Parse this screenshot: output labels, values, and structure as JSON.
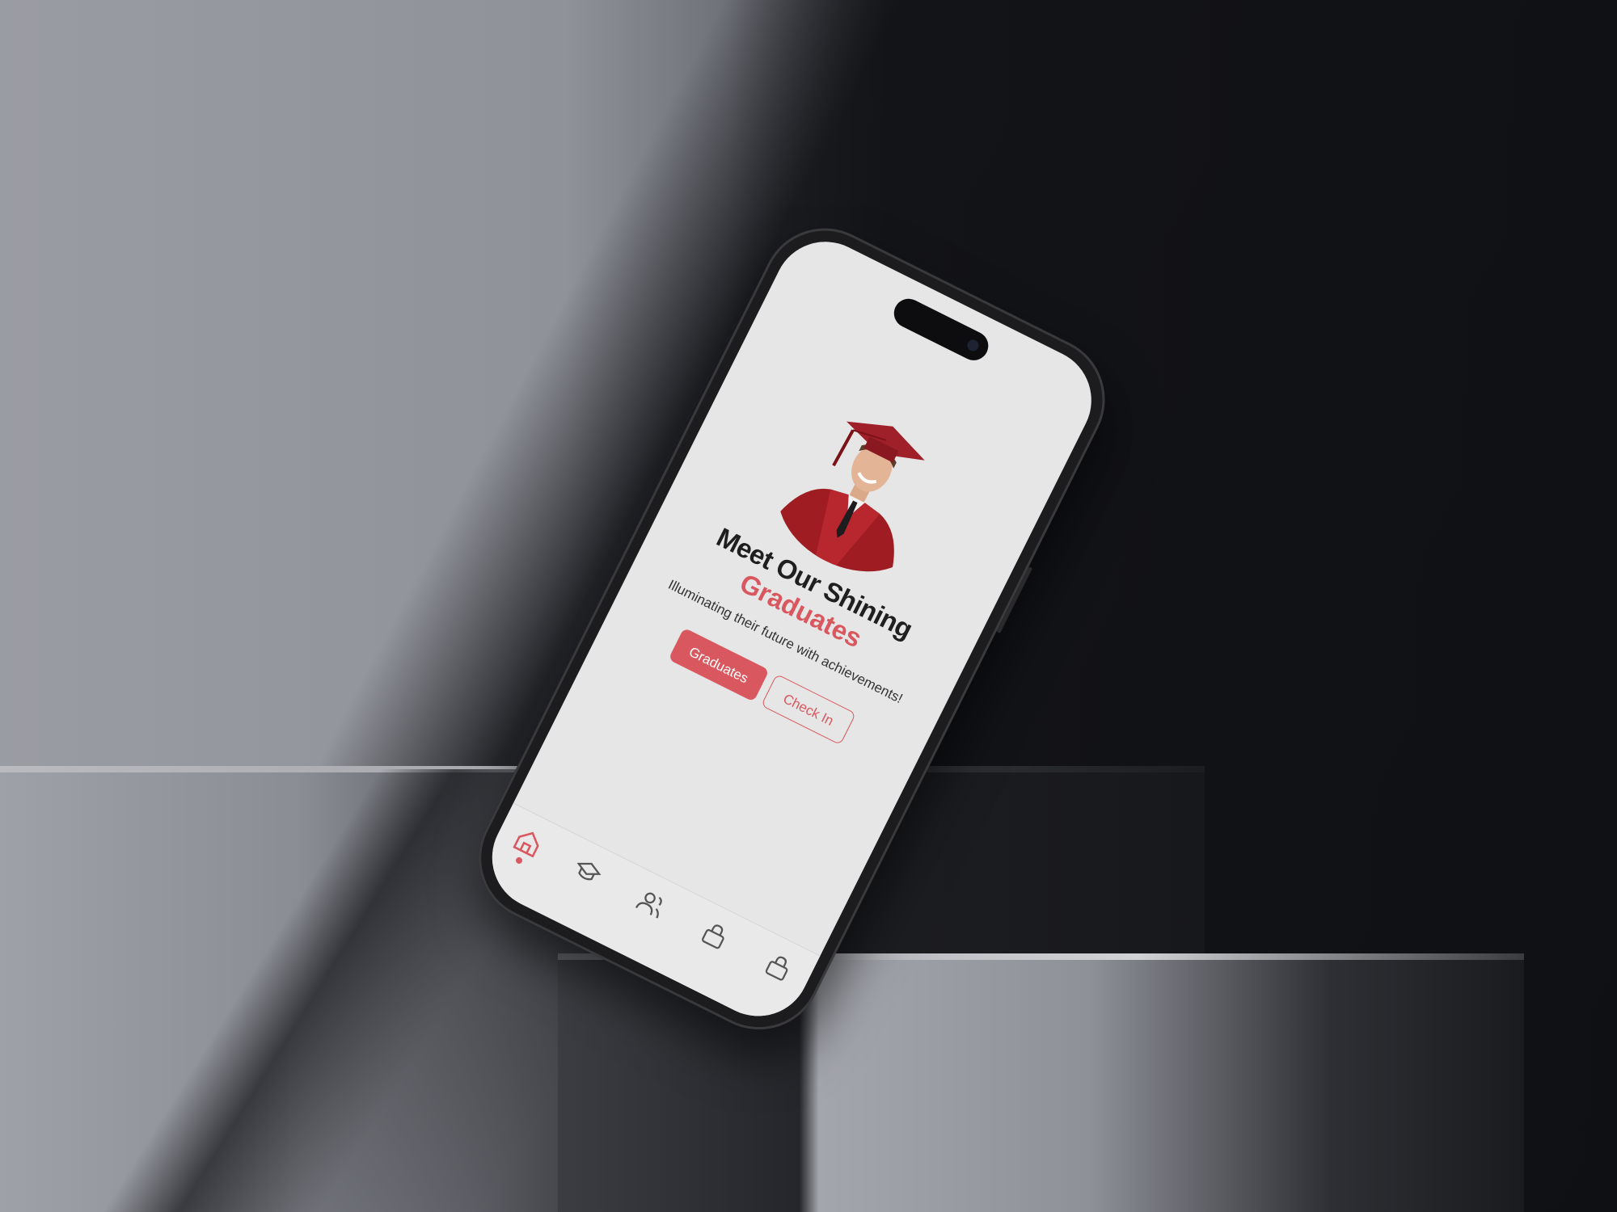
{
  "app": {
    "title_line1": "Meet Our Shining",
    "title_line2": "Graduates",
    "subtitle": "Illuminating their future with achievements!"
  },
  "buttons": {
    "primary_label": "Graduates",
    "secondary_label": "Check In"
  },
  "bottom_nav": {
    "items": [
      {
        "icon": "home-icon",
        "active": true
      },
      {
        "icon": "graduation-cap-icon",
        "active": false
      },
      {
        "icon": "users-icon",
        "active": false
      },
      {
        "icon": "lock-icon",
        "active": false
      },
      {
        "icon": "lock-icon",
        "active": false
      }
    ]
  },
  "colors": {
    "accent": "#d9585f",
    "screen_bg": "#e6e6e6",
    "text_dark": "#1f1f1f"
  }
}
